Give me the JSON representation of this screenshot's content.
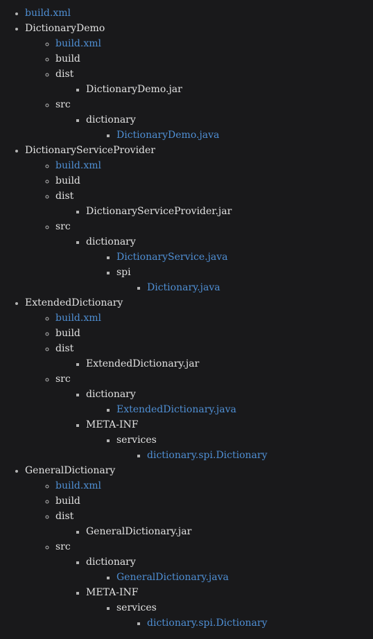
{
  "page": {
    "background_color": "#19191b",
    "text_color": "#e2e2e2",
    "link_color": "#4f8fd4",
    "marker_color": "#b4b4b4",
    "title": "Directory Tree"
  },
  "tree": [
    {
      "label": "build.xml",
      "kind": "link",
      "children": []
    },
    {
      "label": "DictionaryDemo",
      "kind": "plain",
      "children": [
        {
          "label": "build.xml",
          "kind": "link",
          "children": []
        },
        {
          "label": "build",
          "kind": "plain",
          "children": []
        },
        {
          "label": "dist",
          "kind": "plain",
          "children": [
            {
              "label": "DictionaryDemo.jar",
              "kind": "plain",
              "children": []
            }
          ]
        },
        {
          "label": "src",
          "kind": "plain",
          "children": [
            {
              "label": "dictionary",
              "kind": "plain",
              "children": [
                {
                  "label": "DictionaryDemo.java",
                  "kind": "link",
                  "children": []
                }
              ]
            }
          ]
        }
      ]
    },
    {
      "label": "DictionaryServiceProvider",
      "kind": "plain",
      "children": [
        {
          "label": "build.xml",
          "kind": "link",
          "children": []
        },
        {
          "label": "build",
          "kind": "plain",
          "children": []
        },
        {
          "label": "dist",
          "kind": "plain",
          "children": [
            {
              "label": "DictionaryServiceProvider.jar",
              "kind": "plain",
              "children": []
            }
          ]
        },
        {
          "label": "src",
          "kind": "plain",
          "children": [
            {
              "label": "dictionary",
              "kind": "plain",
              "children": [
                {
                  "label": "DictionaryService.java",
                  "kind": "link",
                  "children": []
                },
                {
                  "label": "spi",
                  "kind": "plain",
                  "children": [
                    {
                      "label": "Dictionary.java",
                      "kind": "link",
                      "children": []
                    }
                  ]
                }
              ]
            }
          ]
        }
      ]
    },
    {
      "label": "ExtendedDictionary",
      "kind": "plain",
      "children": [
        {
          "label": "build.xml",
          "kind": "link",
          "children": []
        },
        {
          "label": "build",
          "kind": "plain",
          "children": []
        },
        {
          "label": "dist",
          "kind": "plain",
          "children": [
            {
              "label": "ExtendedDictionary.jar",
              "kind": "plain",
              "children": []
            }
          ]
        },
        {
          "label": "src",
          "kind": "plain",
          "children": [
            {
              "label": "dictionary",
              "kind": "plain",
              "children": [
                {
                  "label": "ExtendedDictionary.java",
                  "kind": "link",
                  "children": []
                }
              ]
            },
            {
              "label": "META-INF",
              "kind": "plain",
              "children": [
                {
                  "label": "services",
                  "kind": "plain",
                  "children": [
                    {
                      "label": "dictionary.spi.Dictionary",
                      "kind": "link",
                      "children": []
                    }
                  ]
                }
              ]
            }
          ]
        }
      ]
    },
    {
      "label": "GeneralDictionary",
      "kind": "plain",
      "children": [
        {
          "label": "build.xml",
          "kind": "link",
          "children": []
        },
        {
          "label": "build",
          "kind": "plain",
          "children": []
        },
        {
          "label": "dist",
          "kind": "plain",
          "children": [
            {
              "label": "GeneralDictionary.jar",
              "kind": "plain",
              "children": []
            }
          ]
        },
        {
          "label": "src",
          "kind": "plain",
          "children": [
            {
              "label": "dictionary",
              "kind": "plain",
              "children": [
                {
                  "label": "GeneralDictionary.java",
                  "kind": "link",
                  "children": []
                }
              ]
            },
            {
              "label": "META-INF",
              "kind": "plain",
              "children": [
                {
                  "label": "services",
                  "kind": "plain",
                  "children": [
                    {
                      "label": "dictionary.spi.Dictionary",
                      "kind": "link",
                      "children": []
                    }
                  ]
                }
              ]
            }
          ]
        }
      ]
    }
  ]
}
